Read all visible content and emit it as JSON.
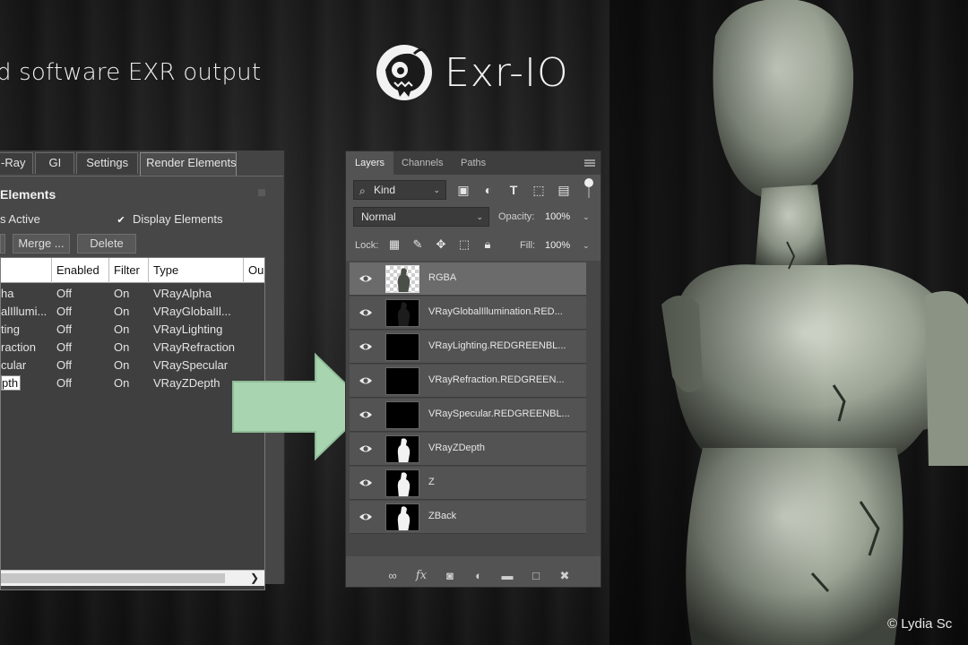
{
  "headline": "d software EXR output",
  "brand": {
    "name": "Exr-IO",
    "logo_icon": "monster-head-logo-icon"
  },
  "copyright": "© Lydia Sc",
  "vray": {
    "tabs": [
      "-Ray",
      "GI",
      "Settings",
      "Render Elements"
    ],
    "active_tab": "Render Elements",
    "rollout_title": "Elements",
    "checkbox_left_label": "s Active",
    "checkbox_right_label": "Display Elements",
    "merge_button": "Merge ...",
    "delete_button": "Delete",
    "columns": [
      "Enabled",
      "Filter",
      "Type",
      "Ou"
    ],
    "rows": [
      {
        "name": "ha",
        "enabled": "Off",
        "filter": "On",
        "type": "VRayAlpha"
      },
      {
        "name": "alIllumi...",
        "enabled": "Off",
        "filter": "On",
        "type": "VRayGlobalIl..."
      },
      {
        "name": "ting",
        "enabled": "Off",
        "filter": "On",
        "type": "VRayLighting"
      },
      {
        "name": "raction",
        "enabled": "Off",
        "filter": "On",
        "type": "VRayRefraction"
      },
      {
        "name": "cular",
        "enabled": "Off",
        "filter": "On",
        "type": "VRaySpecular"
      },
      {
        "name": "pth",
        "enabled": "Off",
        "filter": "On",
        "type": "VRayZDepth"
      }
    ]
  },
  "photoshop": {
    "tabs": [
      "Layers",
      "Channels",
      "Paths"
    ],
    "active_tab": "Layers",
    "kind_filter": "Kind",
    "blend_mode": "Normal",
    "opacity_label": "Opacity:",
    "opacity_value": "100%",
    "lock_label": "Lock:",
    "fill_label": "Fill:",
    "fill_value": "100%",
    "layers": [
      {
        "name": "RGBA",
        "thumb": "checker-figure",
        "selected": true
      },
      {
        "name": "VRayGlobalIllumination.RED...",
        "thumb": "dark-figure",
        "selected": false
      },
      {
        "name": "VRayLighting.REDGREENBL...",
        "thumb": "black",
        "selected": false
      },
      {
        "name": "VRayRefraction.REDGREEN...",
        "thumb": "black",
        "selected": false
      },
      {
        "name": "VRaySpecular.REDGREENBL...",
        "thumb": "black",
        "selected": false
      },
      {
        "name": "VRayZDepth",
        "thumb": "white-figure",
        "selected": false
      },
      {
        "name": "Z",
        "thumb": "white-figure",
        "selected": false
      },
      {
        "name": "ZBack",
        "thumb": "white-figure",
        "selected": false
      }
    ]
  },
  "colors": {
    "arrow": "#a9d4b0",
    "figure_skin": "#b9c1b2",
    "background": "#161616"
  }
}
